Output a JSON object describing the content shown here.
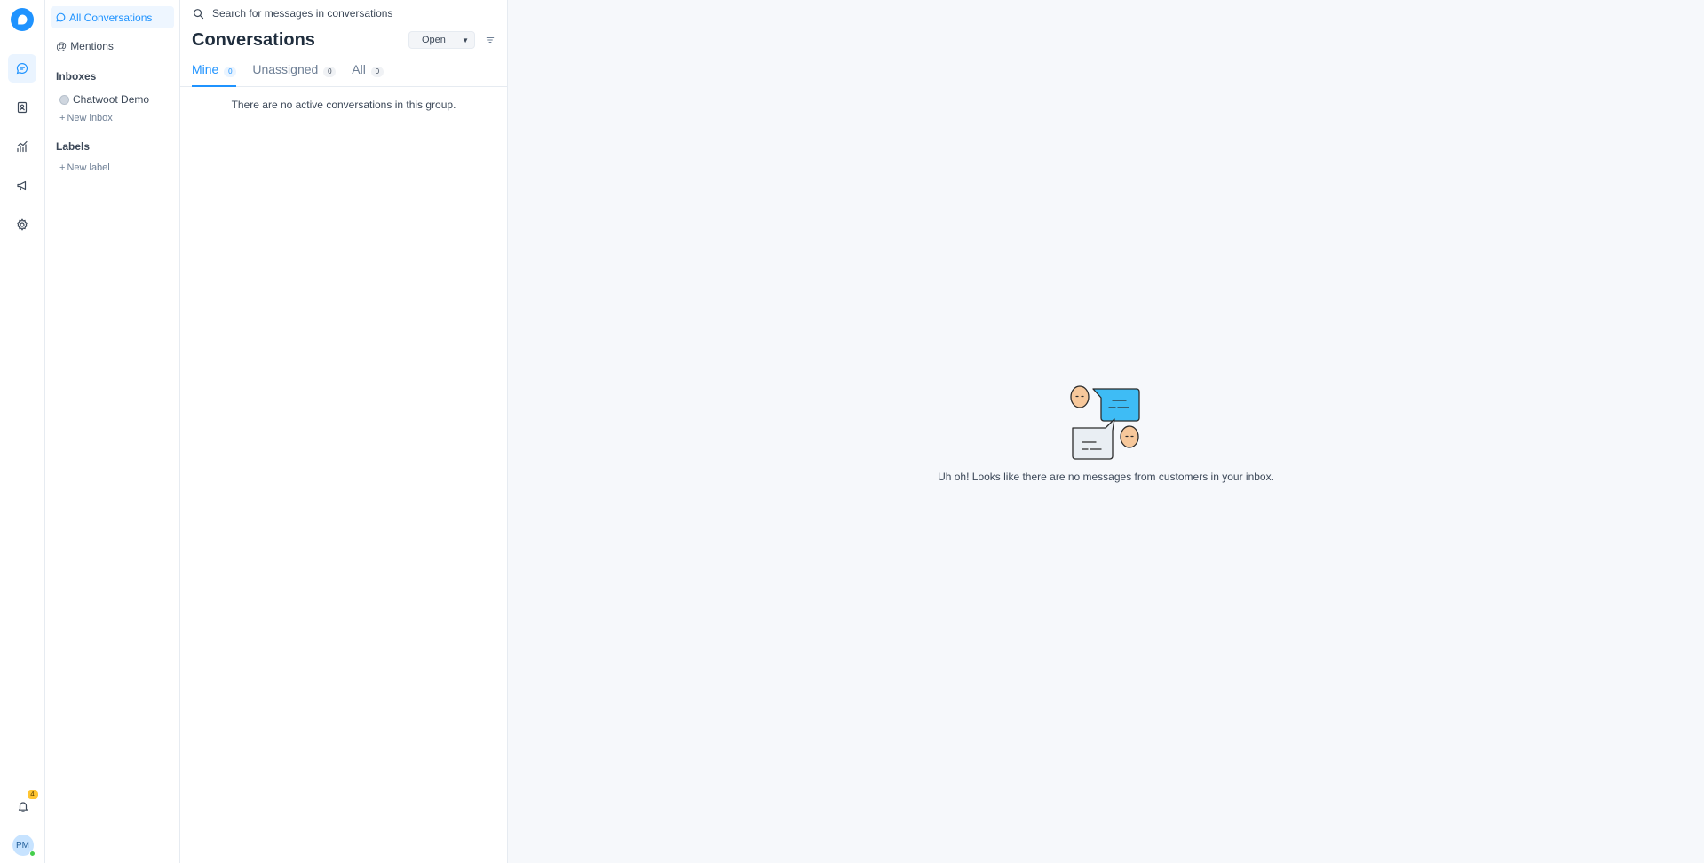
{
  "rail": {
    "nav_icons": [
      "conversations-icon",
      "contacts-icon",
      "reports-icon",
      "campaigns-icon",
      "settings-icon"
    ],
    "notification_count": "4",
    "avatar_initials": "PM",
    "colors": {
      "brand": "#1f93ff",
      "badge": "#ffc532",
      "online": "#44ce4b"
    }
  },
  "sidebar": {
    "all_conversations": "All Conversations",
    "mentions": "Mentions",
    "inboxes_heading": "Inboxes",
    "inbox_name": "Chatwoot Demo",
    "new_inbox": "New inbox",
    "labels_heading": "Labels",
    "new_label": "New label"
  },
  "conversations": {
    "search_placeholder": "Search for messages in conversations",
    "title": "Conversations",
    "status_filter": "Open",
    "tabs": [
      {
        "label": "Mine",
        "count": "0"
      },
      {
        "label": "Unassigned",
        "count": "0"
      },
      {
        "label": "All",
        "count": "0"
      }
    ],
    "empty_message": "There are no active conversations in this group."
  },
  "main": {
    "empty_message": "Uh oh! Looks like there are no messages from customers in your inbox."
  }
}
